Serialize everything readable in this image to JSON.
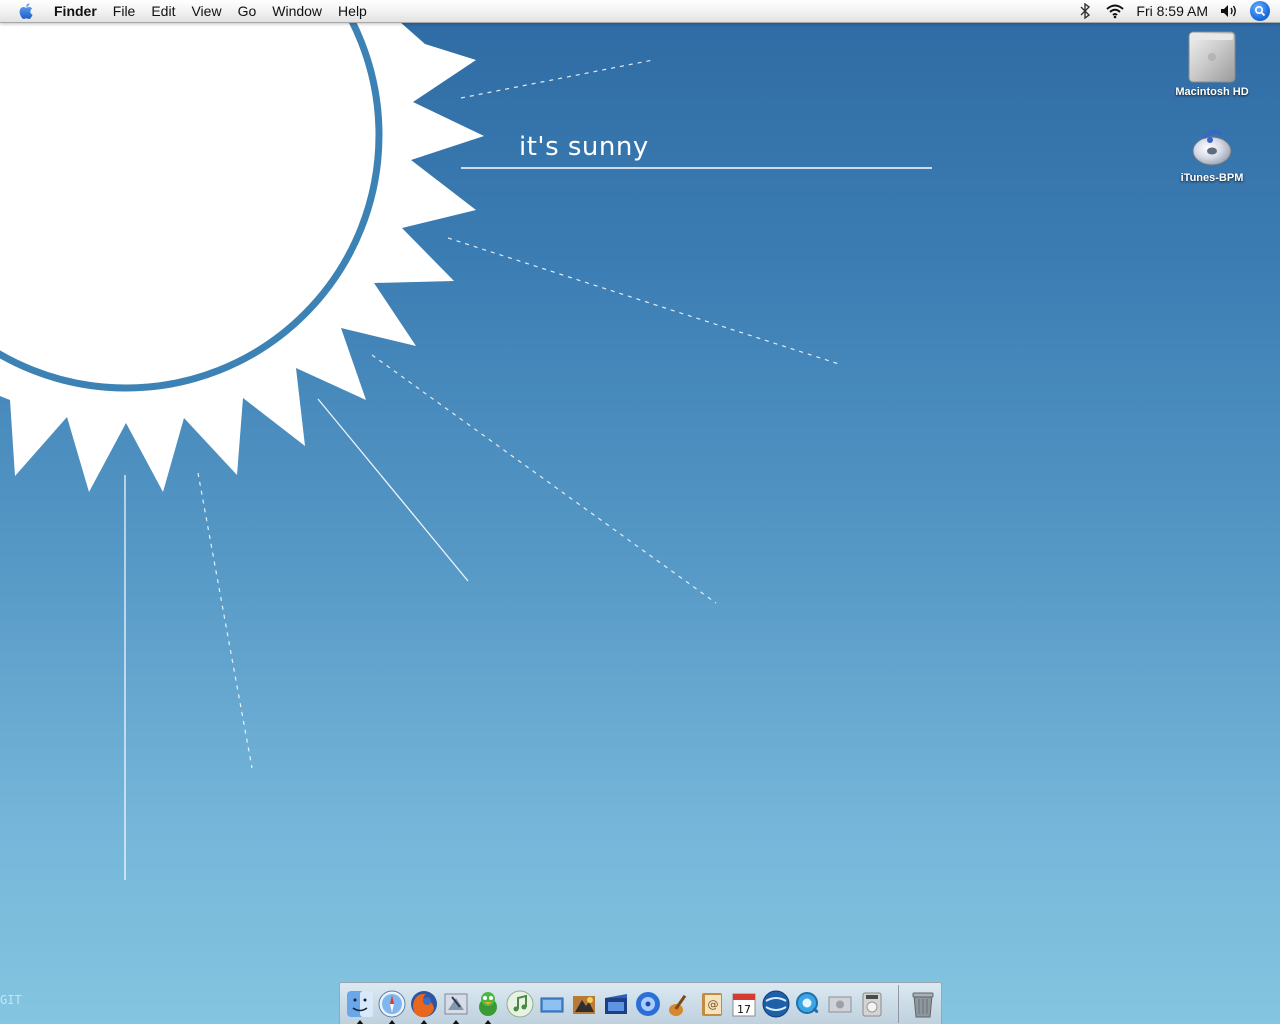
{
  "desktop": {
    "wallpaper_caption": "it's sunny",
    "corner_credit": "GIT",
    "background_top": "#2f6aa3",
    "background_bottom": "#84c5e0"
  },
  "menubar": {
    "apple_icon": "apple-icon",
    "app_name": "Finder",
    "items": [
      "File",
      "Edit",
      "View",
      "Go",
      "Window",
      "Help"
    ],
    "clock": "Fri 8:59 AM",
    "status_icons": [
      "bluetooth-icon",
      "wifi-icon",
      "volume-icon",
      "spotlight-icon"
    ]
  },
  "desktop_icons": [
    {
      "label": "Macintosh HD",
      "icon": "hard-drive-icon"
    },
    {
      "label": "iTunes-BPM",
      "icon": "itunes-disc-icon"
    }
  ],
  "dock": {
    "apps": [
      {
        "name": "Finder",
        "icon": "finder-icon",
        "running": true
      },
      {
        "name": "Safari",
        "icon": "safari-icon",
        "running": true
      },
      {
        "name": "Firefox",
        "icon": "firefox-icon",
        "running": true
      },
      {
        "name": "Mail",
        "icon": "mail-icon",
        "running": true
      },
      {
        "name": "Adium",
        "icon": "adium-icon",
        "running": true
      },
      {
        "name": "iTunes",
        "icon": "itunes-icon",
        "running": false
      },
      {
        "name": "iPhoto",
        "icon": "iphoto-icon",
        "running": false
      },
      {
        "name": "Preview",
        "icon": "preview-icon",
        "running": false
      },
      {
        "name": "iMovie",
        "icon": "imovie-icon",
        "running": false
      },
      {
        "name": "iDVD",
        "icon": "idvd-icon",
        "running": false
      },
      {
        "name": "GarageBand",
        "icon": "garageband-icon",
        "running": false
      },
      {
        "name": "Address Book",
        "icon": "address-book-icon",
        "running": false
      },
      {
        "name": "iCal",
        "icon": "ical-icon",
        "running": false,
        "badge": "17"
      },
      {
        "name": "Google Earth",
        "icon": "google-earth-icon",
        "running": false
      },
      {
        "name": "QuickTime",
        "icon": "quicktime-icon",
        "running": false
      },
      {
        "name": "System Preferences",
        "icon": "system-preferences-icon",
        "running": false
      },
      {
        "name": "DVD Player",
        "icon": "dvd-player-icon",
        "running": false
      }
    ],
    "trash": {
      "name": "Trash",
      "icon": "trash-icon"
    }
  }
}
